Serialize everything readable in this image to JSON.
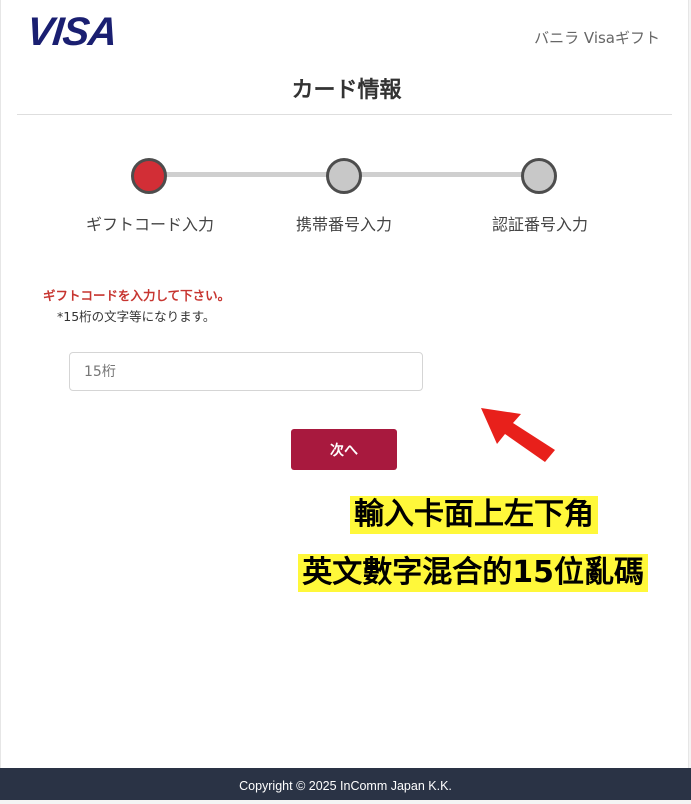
{
  "header": {
    "logo_text": "VISA",
    "brand_name": "バニラ Visaギフト",
    "brand_color": "#1a1f71"
  },
  "title": "カード情報",
  "steps": [
    {
      "label": "ギフトコード入力",
      "active": true
    },
    {
      "label": "携帯番号入力",
      "active": false
    },
    {
      "label": "認証番号入力",
      "active": false
    }
  ],
  "form": {
    "instruction": "ギフトコードを入力して下さい。",
    "note": "*15桁の文字等になります。",
    "input_placeholder": "15桁",
    "next_label": "次へ"
  },
  "annotation": {
    "line1": "輸入卡面上左下角",
    "line2": "英文數字混合的15位亂碼",
    "highlight_color": "#fff83a",
    "arrow_color": "#e8201b"
  },
  "footer": {
    "copyright": "Copyright © 2025 InComm Japan K.K."
  },
  "colors": {
    "accent_red": "#d22e36",
    "button": "#a8193e",
    "footer_bg": "#2a3345"
  }
}
